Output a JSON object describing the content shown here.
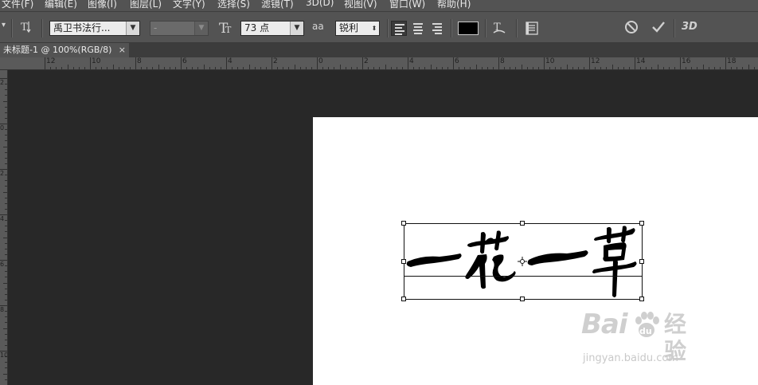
{
  "menu": [
    "文件(F)",
    "编辑(E)",
    "图像(I)",
    "图层(L)",
    "文字(Y)",
    "选择(S)",
    "滤镜(T)",
    "3D(D)",
    "视图(V)",
    "窗口(W)",
    "帮助(H)"
  ],
  "options": {
    "font_family": "禹卫书法行...",
    "font_style": "-",
    "font_size": "73 点",
    "aa_label": "aa",
    "anti_alias": "锐利",
    "text_color": "#000000",
    "three_d": "3D"
  },
  "document": {
    "tab_title": "未标题-1 @ 100%(RGB/8)",
    "close": "×",
    "canvas_text": "一花一草"
  },
  "rulers": {
    "h_labels": [
      "12",
      "10",
      "8",
      "6",
      "4",
      "2",
      "0",
      "2",
      "4",
      "6",
      "8",
      "10",
      "12",
      "14",
      "16",
      "18"
    ],
    "v_labels": [
      "2",
      "0",
      "2",
      "4",
      "6",
      "8",
      "10"
    ]
  },
  "watermark": {
    "brand": "Bai",
    "brand_cn": "经验",
    "url": "jingyan.baidu.com"
  },
  "colors": {
    "ui_dark": "#535353",
    "workspace": "#282828",
    "canvas": "#ffffff"
  }
}
